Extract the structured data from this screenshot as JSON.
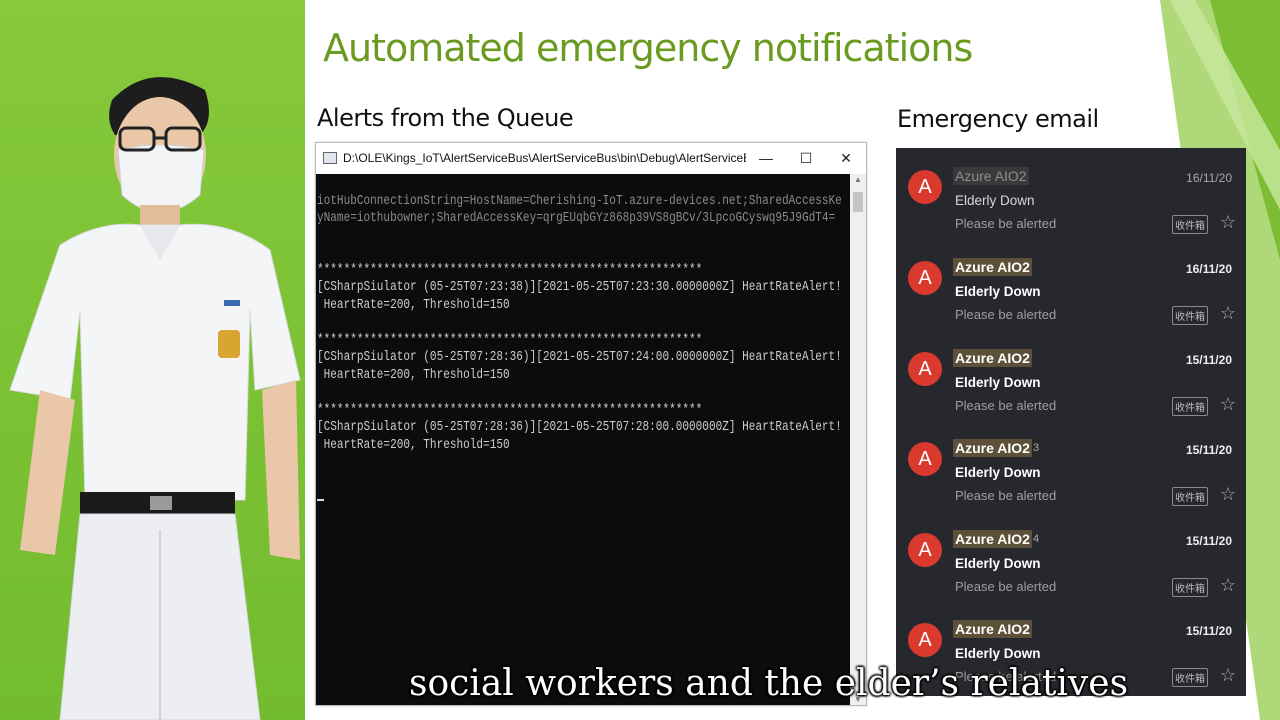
{
  "slide": {
    "title": "Automated emergency notifications",
    "queue_label": "Alerts from the Queue",
    "email_label": "Emergency email"
  },
  "console": {
    "window_title": "D:\\OLE\\Kings_IoT\\AlertServiceBus\\AlertServiceBus\\bin\\Debug\\AlertServiceBus.exe",
    "minimize_icon": "minimize-icon",
    "maximize_icon": "maximize-icon",
    "close_icon": "close-icon",
    "lines": [
      "iotHubConnectionString=HostName=Cherishing-IoT.azure-devices.net;SharedAccessKe",
      "yName=iothubowner;SharedAccessKey=qrgEUqbGYz868p39VS8gBCv/3LpcoGCyswq95J9GdT4=",
      "**********************************************************",
      "[CSharpSiulator (05-25T07:23:38)][2021-05-25T07:23:30.0000000Z] HeartRateAlert!",
      " HeartRate=200, Threshold=150",
      "**********************************************************",
      "[CSharpSiulator (05-25T07:28:36)][2021-05-25T07:24:00.0000000Z] HeartRateAlert!",
      " HeartRate=200, Threshold=150",
      "**********************************************************",
      "[CSharpSiulator (05-25T07:28:36)][2021-05-25T07:28:00.0000000Z] HeartRateAlert!",
      " HeartRate=200, Threshold=150"
    ]
  },
  "emails": [
    {
      "sender": "Azure AIO2",
      "count": "",
      "date": "16/11/20",
      "subject": "Elderly Down",
      "snippet": "Please be alerted",
      "folder": "收件箱",
      "read": true
    },
    {
      "sender": "Azure AIO2",
      "count": "",
      "date": "16/11/20",
      "subject": "Elderly Down",
      "snippet": "Please be alerted",
      "folder": "收件箱",
      "read": false
    },
    {
      "sender": "Azure AIO2",
      "count": "",
      "date": "15/11/20",
      "subject": "Elderly Down",
      "snippet": "Please be alerted",
      "folder": "收件箱",
      "read": false
    },
    {
      "sender": "Azure AIO2",
      "count": "3",
      "date": "15/11/20",
      "subject": "Elderly Down",
      "snippet": "Please be alerted",
      "folder": "收件箱",
      "read": false
    },
    {
      "sender": "Azure AIO2",
      "count": "4",
      "date": "15/11/20",
      "subject": "Elderly Down",
      "snippet": "Please be alerted",
      "folder": "收件箱",
      "read": false
    },
    {
      "sender": "Azure AIO2",
      "count": "",
      "date": "15/11/20",
      "subject": "Elderly Down",
      "snippet": "Please be alerted",
      "folder": "收件箱",
      "read": false
    }
  ],
  "email_avatar_letter": "A",
  "subtitle": "social workers and the elder’s relatives",
  "colors": {
    "accent_green": "#6a9a1f",
    "avatar_red": "#d93a2d",
    "console_bg": "#0c0c0c",
    "email_bg": "#26282d"
  }
}
